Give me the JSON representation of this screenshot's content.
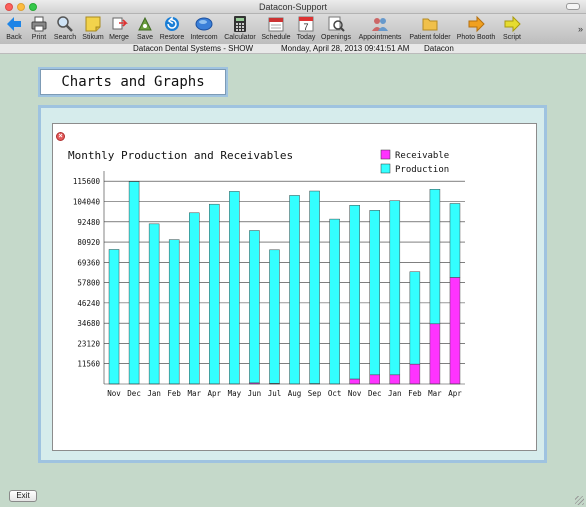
{
  "window": {
    "title": "Datacon-Support"
  },
  "toolbar": {
    "items": [
      {
        "label": "Back",
        "icon": "back-arrow-icon"
      },
      {
        "label": "Print",
        "icon": "printer-icon"
      },
      {
        "label": "Search",
        "icon": "magnifier-icon"
      },
      {
        "label": "Stikum",
        "icon": "sticky-note-icon"
      },
      {
        "label": "Merge",
        "icon": "merge-icon"
      },
      {
        "label": "Save",
        "icon": "save-icon"
      },
      {
        "label": "Restore",
        "icon": "restore-icon"
      },
      {
        "label": "Intercom",
        "icon": "intercom-icon"
      },
      {
        "label": "Calculator",
        "icon": "calculator-icon"
      },
      {
        "label": "Schedule",
        "icon": "schedule-icon"
      },
      {
        "label": "Today",
        "icon": "calendar-today-icon"
      },
      {
        "label": "Openings",
        "icon": "openings-icon"
      },
      {
        "label": "Appointments",
        "icon": "appointments-icon"
      },
      {
        "label": "Patient folder",
        "icon": "folder-icon"
      },
      {
        "label": "Photo Booth",
        "icon": "photo-booth-icon"
      },
      {
        "label": "Script",
        "icon": "script-icon"
      }
    ],
    "overflow_label": "»",
    "calendar_day": "7"
  },
  "status": {
    "system": "Datacon Dental Systems - SHOW",
    "datetime": "Monday, April 28, 2013  09:41:51 AM",
    "user": "Datacon"
  },
  "page": {
    "header": "Charts and Graphs"
  },
  "close_glyph": "×",
  "footer": {
    "exit_label": "Exit"
  },
  "colors": {
    "receivable": "#ff33ff",
    "production": "#33ffff",
    "frame": "#9fc3e0",
    "background": "#c5d9ca"
  },
  "chart_data": {
    "type": "bar",
    "stacked": true,
    "title": "Monthly Production and Receivables",
    "categories": [
      "Nov",
      "Dec",
      "Jan",
      "Feb",
      "Mar",
      "Apr",
      "May",
      "Jun",
      "Jul",
      "Aug",
      "Sep",
      "Oct",
      "Nov",
      "Dec",
      "Jan",
      "Feb",
      "Mar",
      "Apr"
    ],
    "series": [
      {
        "name": "Receivable",
        "color": "#ff33ff",
        "values": [
          0,
          0,
          0,
          0,
          0,
          0,
          0,
          600,
          300,
          0,
          200,
          0,
          2800,
          5200,
          5200,
          11300,
          34300,
          60700
        ]
      },
      {
        "name": "Production",
        "color": "#33ffff",
        "values": [
          76700,
          115400,
          91300,
          82300,
          97600,
          102500,
          109800,
          86900,
          76200,
          107500,
          109800,
          94000,
          99100,
          93800,
          99300,
          52700,
          76700,
          42200
        ]
      }
    ],
    "yticks": [
      "115600",
      "104040",
      "92480",
      "80920",
      "69360",
      "57800",
      "46240",
      "34680",
      "23120",
      "11560"
    ],
    "ylim": [
      0,
      118000
    ],
    "grid": true,
    "legend_position": "top-right"
  }
}
